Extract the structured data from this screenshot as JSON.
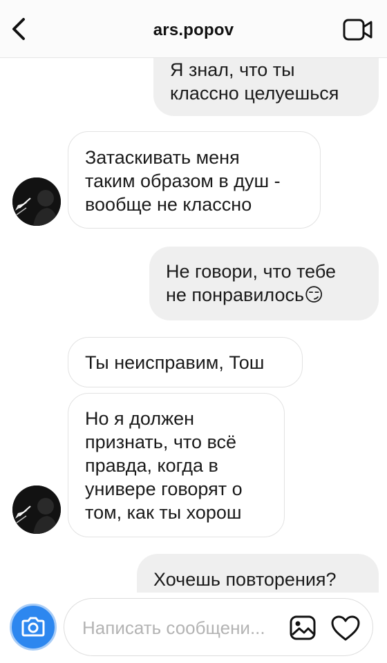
{
  "header": {
    "title": "ars.popov",
    "back_icon": "chevron-left-icon",
    "video_icon": "video-camera-icon"
  },
  "messages": [
    {
      "direction": "outgoing",
      "text": "Я знал, что ты\nклассно целуешься"
    },
    {
      "direction": "incoming",
      "text": "Затаскивать меня\nтаким образом в душ -\nвообще не классно"
    },
    {
      "direction": "outgoing",
      "text": "Не говори, что тебе\nне понравилось😏"
    },
    {
      "direction": "incoming",
      "text": "Ты неисправим, Тош"
    },
    {
      "direction": "incoming",
      "text": "Но я должен\nпризнать, что всё\nправда, когда в\nунивере говорят о\nтом, как ты хорош"
    },
    {
      "direction": "outgoing",
      "text": "Хочешь повторения?"
    }
  ],
  "composer": {
    "placeholder": "Написать сообщени...",
    "camera_icon": "camera-icon",
    "gallery_icon": "gallery-icon",
    "heart_icon": "heart-icon"
  },
  "colors": {
    "accent": "#2d87ef",
    "outgoing_bubble": "#efefef",
    "incoming_border": "#e2e2e2"
  }
}
